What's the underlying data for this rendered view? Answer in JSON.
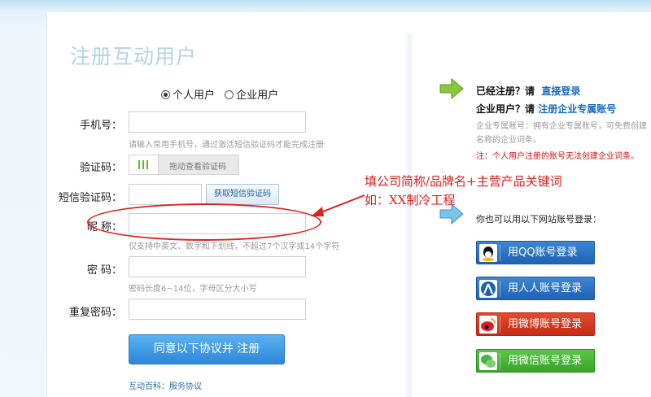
{
  "page": {
    "title": "注册互动用户"
  },
  "account_type": {
    "options": [
      "个人用户",
      "企业用户"
    ],
    "selected": "个人用户"
  },
  "form": {
    "phone_label": "手机号：",
    "phone_hint": "请输入常用手机号，通过激活短信验证码才能完成注册",
    "captcha_label": "验证码：",
    "captcha_slider_text": "拖动查看验证码",
    "sms_label": "短信验证码：",
    "sms_button": "获取短信验证码",
    "nickname_label": "昵  称：",
    "nickname_hint": "仅支持中英文、数字和下划线，不超过7个汉字或14个字符",
    "password_label": "密  码：",
    "password_hint": "密码长度6~14位，字母区分大小写",
    "confirm_label": "重复密码：",
    "submit": "同意以下协议并 注册",
    "agreement_prefix": "互动百科：",
    "agreement_link": "服务协议"
  },
  "annotation": {
    "line1": "填公司简称/品牌名+主营产品关键词",
    "line2": "如：XX制冷工程"
  },
  "right": {
    "registered_text": "已经注册？请",
    "login_link": "直接登录",
    "enterprise_text": "企业用户？请",
    "enterprise_link": "注册企业专属账号",
    "enterprise_desc1": "企业专属账号：拥有企业专属账号，可免费创建",
    "enterprise_desc2": "名称的企业词条。",
    "note": "注：个人用户注册的账号无法创建企业词条。",
    "other_login": "你也可以用以下网站账号登录：",
    "social": {
      "qq": "用QQ账号登录",
      "renren": "用人人账号登录",
      "weibo": "用微博账号登录",
      "wechat": "用微信账号登录"
    }
  },
  "colors": {
    "primary": "#2c87d8",
    "link": "#1a6cc0",
    "annotation": "#e02020",
    "title": "#b6d3e6"
  }
}
